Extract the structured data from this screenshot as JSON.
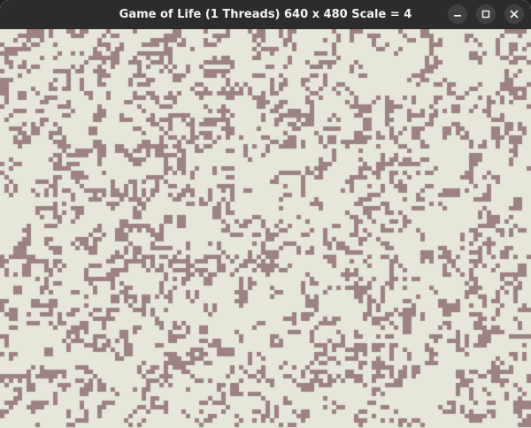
{
  "window": {
    "title": "Game of Life (1 Threads) 640 x 480 Scale = 4",
    "controls": {
      "minimize_icon": "minimize-icon",
      "maximize_icon": "maximize-icon",
      "close_icon": "close-icon"
    }
  },
  "simulation": {
    "background_color": "#e6e6da",
    "cell_color": "#9c8283",
    "titlebar_color": "#2c2c2c"
  }
}
